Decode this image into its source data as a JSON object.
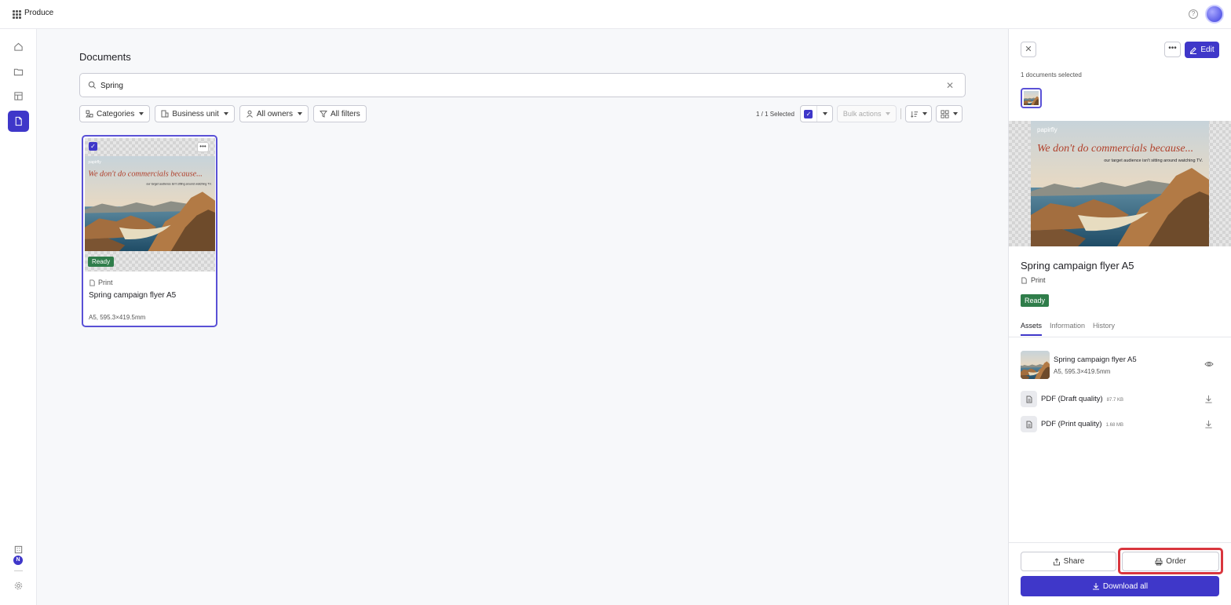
{
  "app": {
    "title": "Produce"
  },
  "page": {
    "title": "Documents"
  },
  "search": {
    "value": "Spring",
    "placeholder": ""
  },
  "filters": {
    "categories": "Categories",
    "business_unit": "Business unit",
    "owners": "All owners",
    "all_filters": "All filters"
  },
  "toolbar": {
    "selected_count": "1 / 1 Selected",
    "bulk_actions": "Bulk actions"
  },
  "card": {
    "status": "Ready",
    "type": "Print",
    "title": "Spring campaign flyer A5",
    "meta": "A5, 595.3×419.5mm"
  },
  "flyer": {
    "brand": "papirfly",
    "headline": "We don't do commercials because...",
    "tagline": "our target audience isn't sitting around watching TV."
  },
  "panel": {
    "selected_text": "1 documents selected",
    "edit_label": "Edit",
    "title": "Spring campaign flyer A5",
    "type": "Print",
    "status": "Ready",
    "tabs": [
      {
        "label": "Assets",
        "active": true
      },
      {
        "label": "Information",
        "active": false
      },
      {
        "label": "History",
        "active": false
      }
    ],
    "asset": {
      "name": "Spring campaign flyer A5",
      "meta": "A5, 595.3×419.5mm"
    },
    "files": [
      {
        "name": "PDF (Draft quality)",
        "size": "87.7 KB"
      },
      {
        "name": "PDF (Print quality)",
        "size": "1.68 MB"
      }
    ],
    "share_label": "Share",
    "order_label": "Order",
    "download_label": "Download all"
  },
  "colors": {
    "accent": "#3f37c9",
    "status_ready": "#2f7d4a",
    "highlight": "#d9363e"
  },
  "rail": {
    "notification_badge": "N"
  }
}
